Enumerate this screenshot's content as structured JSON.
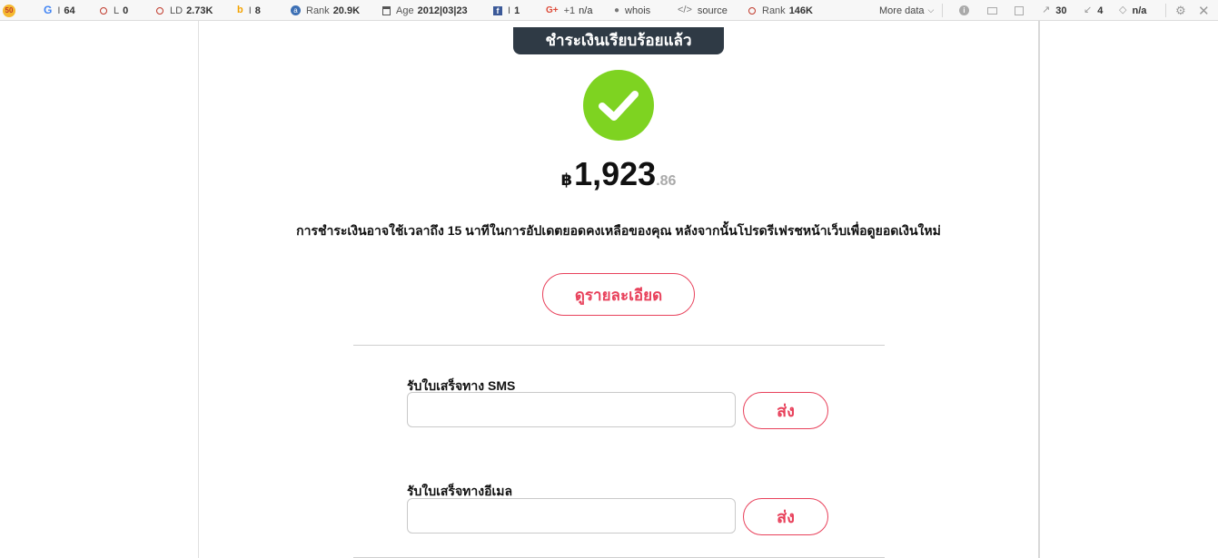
{
  "seo_toolbar": {
    "logo_text": "50",
    "google_index": {
      "label": "I",
      "value": "64"
    },
    "links": {
      "label": "L",
      "value": "0"
    },
    "linking_domains": {
      "label": "LD",
      "value": "2.73K"
    },
    "bing_index": {
      "label": "I",
      "value": "8"
    },
    "alexa_rank": {
      "label": "Rank",
      "value": "20.9K"
    },
    "age": {
      "label": "Age",
      "value": "2012|03|23"
    },
    "facebook": {
      "label": "I",
      "value": "1"
    },
    "google_plus": {
      "label": "+1",
      "value": "n/a"
    },
    "whois": "whois",
    "source": "source",
    "semrush_rank": {
      "label": "Rank",
      "value": "146K"
    },
    "more_data": "More data",
    "external_links": "30",
    "internal_links": "4",
    "robots": "n/a"
  },
  "page": {
    "status_banner": "ชำระเงินเรียบร้อยแล้ว",
    "amount": {
      "currency": "฿",
      "main": "1,923",
      "decimal": ".86"
    },
    "notice": "การชำระเงินอาจใช้เวลาถึง 15 นาทีในการอัปเดตยอดคงเหลือของคุณ หลังจากนั้นโปรดรีเฟรชหน้าเว็บเพื่อดูยอดเงินใหม่",
    "details_button": "ดูรายละเอียด",
    "sms": {
      "label": "รับใบเสร็จทาง SMS",
      "value": "",
      "send": "ส่ง"
    },
    "email": {
      "label": "รับใบเสร็จทางอีเมล",
      "value": "",
      "send": "ส่ง"
    }
  },
  "colors": {
    "accent": "#e8415b",
    "success": "#7ed321",
    "banner": "#2f3a45"
  }
}
